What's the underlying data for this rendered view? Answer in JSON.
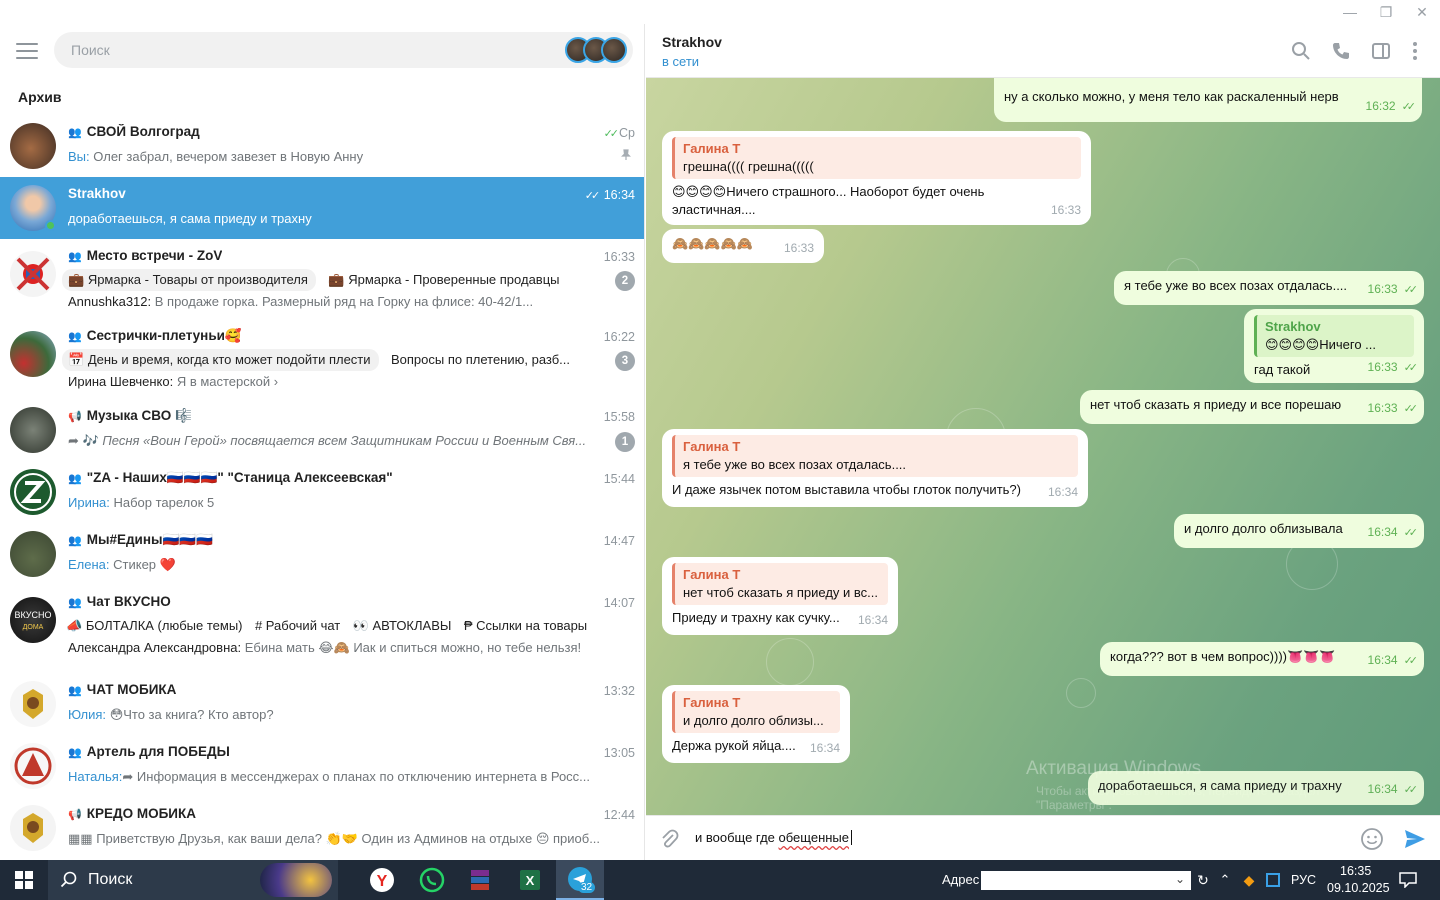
{
  "left": {
    "search_placeholder": "Поиск",
    "archive_label": "Архив",
    "chats": [
      {
        "name": "СВОЙ Волгоград",
        "time": "Ср",
        "sender": "Вы:",
        "message": "Олег забрал, вечером завезет в Новую Анну",
        "pinned": true
      },
      {
        "name": "Strakhov",
        "time": "16:34",
        "message": "доработаешься, я сама приеду и трахну"
      },
      {
        "name": "Место встречи - ZoV",
        "time": "16:33",
        "topic1": "Ярмарка - Товары от производителя",
        "topic2": "Ярмарка - Проверенные продавцы",
        "badge": "2",
        "sender": "Annushka312:",
        "message": "В продаже горка.  Размерный ряд на Горку на флисе: 40-42/1..."
      },
      {
        "name": "Сестрички-плетуньи🥰",
        "time": "16:22",
        "topic1": "День и время, когда кто может подойти плести",
        "topic2": "Вопросы по плетению, разб...",
        "badge": "3",
        "sender": "Ирина Шевченко:",
        "message": "Я в мастерской"
      },
      {
        "name": "Музыка СВО 🎼",
        "time": "15:58",
        "message": "Песня «Воин Герой» посвящается всем Защитникам России и Военным Свя...",
        "badge": "1"
      },
      {
        "name": "\"ZA - Наших🇷🇺🇷🇺🇷🇺\" \"Станица Алексеевская\"",
        "time": "15:44",
        "sender": "Ирина:",
        "message": "Набор тарелок 5"
      },
      {
        "name": "Мы#Едины🇷🇺🇷🇺🇷🇺",
        "time": "14:47",
        "sender": "Елена:",
        "message": "Стикер ❤️"
      },
      {
        "name": "Чат ВКУСНО",
        "time": "14:07",
        "topic1": "БОЛТАЛКА (любые темы)",
        "topic2": "# Рабочий чат",
        "topic3": "👀 АВТОКЛАВЫ",
        "topic4": "Ссылки на товары",
        "sender": "Александра Александровна:",
        "message": "Ебина мать 😂🙈  Иак и спиться можно, но тебе нельзя!"
      },
      {
        "name": "ЧАТ МОБИКА",
        "time": "13:32",
        "sender": "Юлия:",
        "message": "😳Что за книга? Кто автор?"
      },
      {
        "name": "Артель для ПОБЕДЫ",
        "time": "13:05",
        "sender": "Наталья:",
        "message": "Информация в мессенджерах о планах по отключению интернета в Росс..."
      },
      {
        "name": "КРЕДО МОБИКА",
        "time": "12:44",
        "message": "Приветствую Друзья, как ваши дела? 👏🤝  Один из Админов на отдыхе 😔 приоб..."
      }
    ]
  },
  "header": {
    "name": "Strakhov",
    "status": "в сети"
  },
  "messages": [
    {
      "dir": "out",
      "text": "ну а сколько можно, у меня тело как раскаленный нерв",
      "time": "16:32"
    },
    {
      "dir": "in",
      "quote_name": "Галина Т",
      "quote_text": "грешна(((( грешна(((((",
      "text": "😊😊😊😊Ничего страшного... Наоборот будет очень эластичная....",
      "time": "16:33"
    },
    {
      "dir": "in",
      "text": "🙈🙈🙈🙈🙈",
      "time": "16:33"
    },
    {
      "dir": "out",
      "text": "я тебе уже во всех позах отдалась....",
      "time": "16:33"
    },
    {
      "dir": "out",
      "quote_name": "Strakhov",
      "quote_text": "😊😊😊😊Ничего ...",
      "text": "гад такой",
      "time": "16:33"
    },
    {
      "dir": "out",
      "text": "нет чтоб сказать я приеду и все порешаю",
      "time": "16:33"
    },
    {
      "dir": "in",
      "quote_name": "Галина Т",
      "quote_text": "я тебе уже во всех позах отдалась....",
      "text": "И даже язычек потом выставила чтобы глоток получить?)",
      "time": "16:34"
    },
    {
      "dir": "out",
      "text": "и долго долго облизывала",
      "time": "16:34"
    },
    {
      "dir": "in",
      "quote_name": "Галина Т",
      "quote_text": "нет чтоб сказать я приеду и вс...",
      "text": "Приеду и трахну как сучку...",
      "time": "16:34"
    },
    {
      "dir": "out",
      "text": "когда??? вот в чем вопрос))))👅👅👅",
      "time": "16:34"
    },
    {
      "dir": "in",
      "quote_name": "Галина Т",
      "quote_text": "и долго долго облизы...",
      "text": "Держа рукой яйца....",
      "time": "16:34"
    },
    {
      "dir": "out",
      "text": "доработаешься, я сама приеду и трахну",
      "time": "16:34"
    }
  ],
  "watermark": {
    "line1": "Активация Windows",
    "line2": "Чтобы активировать Windows, перейдите в раздел",
    "line3": "\"Параметры\"."
  },
  "composer": {
    "text_before": "и вообще где ",
    "text_underlined": "обещенные"
  },
  "taskbar": {
    "search_label": "Поиск",
    "telegram_badge": "32",
    "address_label": "Адрес",
    "lang": "РУС",
    "time": "16:35",
    "date": "09.10.2025"
  },
  "colors": {
    "accent": "#419fd9",
    "online": "#4fc25a",
    "out_bubble": "#effdde",
    "quote": "#e5826a"
  }
}
